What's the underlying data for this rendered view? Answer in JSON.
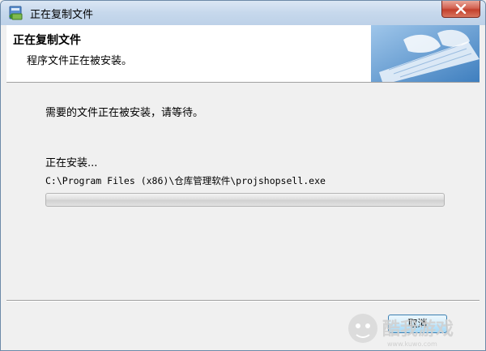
{
  "window": {
    "title": "正在复制文件",
    "icons": {
      "app": "installer-icon",
      "close": "close-icon"
    }
  },
  "header": {
    "title": "正在复制文件",
    "subtitle": "程序文件正在被安装。",
    "image": "keyboard-hands-image"
  },
  "body": {
    "message": "需要的文件正在被安装，请等待。",
    "status": "正在安装...",
    "current_file": "C:\\Program Files (x86)\\仓库管理软件\\projshopsell.exe",
    "progress": 0
  },
  "buttons": {
    "cancel": "取消"
  },
  "watermark": {
    "text": "酷我游戏",
    "url": "www.kuwo.com"
  },
  "colors": {
    "titlebar": "#c6d8ec",
    "progress_fill": "#06b025",
    "close": "#c3402c"
  }
}
